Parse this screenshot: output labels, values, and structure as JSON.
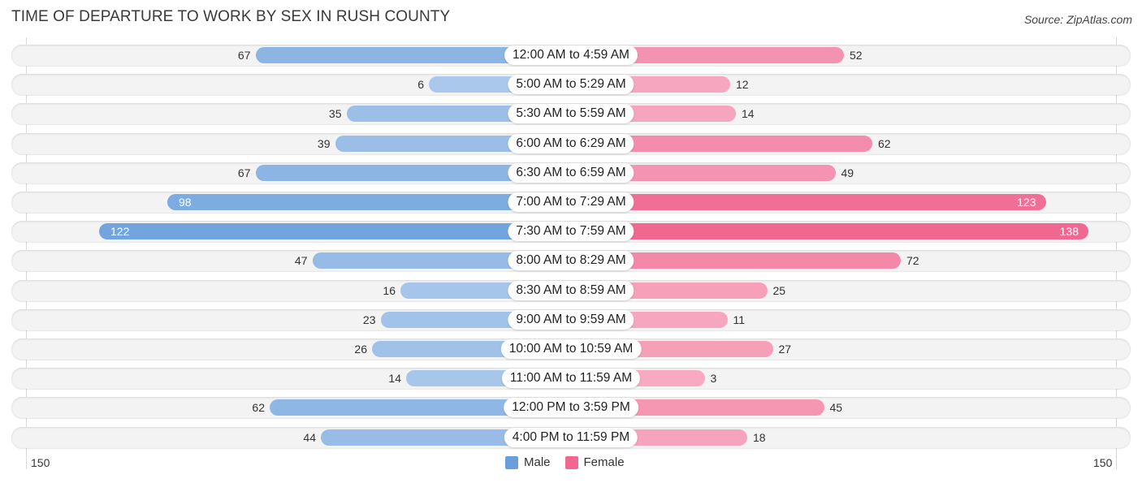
{
  "title": "TIME OF DEPARTURE TO WORK BY SEX IN RUSH COUNTY",
  "source": "Source: ZipAtlas.com",
  "colors": {
    "male": "#6a9fdc",
    "female": "#f06892"
  },
  "chart_data": {
    "type": "bar",
    "orientation": "horizontal-diverging",
    "title": "TIME OF DEPARTURE TO WORK BY SEX IN RUSH COUNTY",
    "categories": [
      "12:00 AM to 4:59 AM",
      "5:00 AM to 5:29 AM",
      "5:30 AM to 5:59 AM",
      "6:00 AM to 6:29 AM",
      "6:30 AM to 6:59 AM",
      "7:00 AM to 7:29 AM",
      "7:30 AM to 7:59 AM",
      "8:00 AM to 8:29 AM",
      "8:30 AM to 8:59 AM",
      "9:00 AM to 9:59 AM",
      "10:00 AM to 10:59 AM",
      "11:00 AM to 11:59 AM",
      "12:00 PM to 3:59 PM",
      "4:00 PM to 11:59 PM"
    ],
    "series": [
      {
        "name": "Male",
        "values": [
          67,
          6,
          35,
          39,
          67,
          98,
          122,
          47,
          16,
          23,
          26,
          14,
          62,
          44
        ]
      },
      {
        "name": "Female",
        "values": [
          52,
          12,
          14,
          62,
          49,
          123,
          138,
          72,
          25,
          11,
          27,
          3,
          45,
          18
        ]
      }
    ],
    "axis": {
      "left_tick": "150",
      "right_tick": "150",
      "range": [
        0,
        150
      ]
    },
    "legend": {
      "position": "bottom-center",
      "entries": [
        "Male",
        "Female"
      ]
    },
    "xlabel": "",
    "ylabel": ""
  }
}
